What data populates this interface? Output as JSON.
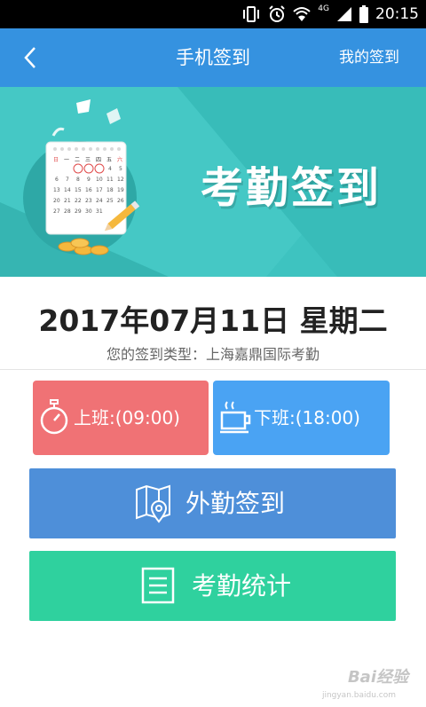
{
  "status_bar": {
    "time": "20:15",
    "icons": [
      "vibrate-icon",
      "alarm-icon",
      "wifi-icon",
      "signal-icon",
      "battery-icon"
    ],
    "network_label": "4G"
  },
  "header": {
    "title": "手机签到",
    "right_link": "我的签到",
    "back_icon": "chevron-left-icon",
    "background": "#3592e0"
  },
  "banner": {
    "title": "考勤签到",
    "background": "#3ec3c0",
    "illustration": {
      "calendar_weekdays": [
        "日",
        "一",
        "二",
        "三",
        "四",
        "五",
        "六"
      ],
      "calendar_days": [
        "1",
        "2",
        "3",
        "4",
        "5",
        "6",
        "7",
        "8",
        "9",
        "10",
        "11",
        "12",
        "13",
        "14",
        "15",
        "16",
        "17",
        "18",
        "19",
        "20",
        "21",
        "22",
        "23",
        "24",
        "25",
        "26",
        "27",
        "28",
        "29",
        "30",
        "31"
      ]
    }
  },
  "info": {
    "date": "2017年07月11日 星期二",
    "signin_type": "您的签到类型：上海嘉鼎国际考勤"
  },
  "buttons": {
    "on_duty": {
      "label": "上班:(09:00)",
      "icon": "stopwatch-icon",
      "color": "#f07275"
    },
    "off_duty": {
      "label": "下班:(18:00)",
      "icon": "coffee-cup-icon",
      "color": "#4aa3f3"
    },
    "field_signin": {
      "label": "外勤签到",
      "icon": "map-pin-icon",
      "color": "#4e8fd9"
    },
    "attendance_stats": {
      "label": "考勤统计",
      "icon": "document-list-icon",
      "color": "#2fd19e"
    }
  },
  "watermark": {
    "brand": "Bai经验",
    "url": "jingyan.baidu.com"
  }
}
